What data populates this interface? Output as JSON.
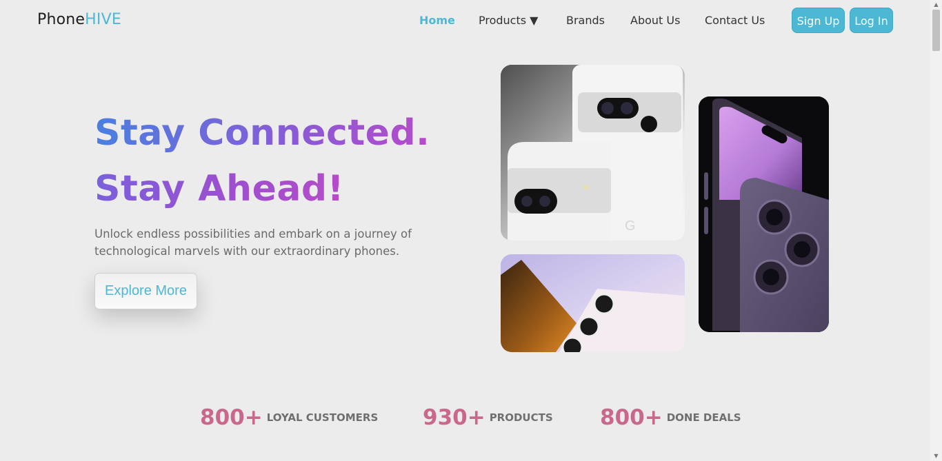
{
  "logo": {
    "part1": "Phone",
    "part2": "HIVE"
  },
  "nav": {
    "home": "Home",
    "products": "Products ▼",
    "brands": "Brands",
    "about": "About Us",
    "contact": "Contact Us",
    "signup": "Sign Up",
    "login": "Log In"
  },
  "hero": {
    "title1": "Stay Connected.",
    "title2": "Stay Ahead!",
    "subtitle": "Unlock endless possibilities and embark on a journey of technological marvels with our extraordinary phones.",
    "cta": "Explore More"
  },
  "stats": [
    {
      "num": "800+",
      "label": "LOYAL CUSTOMERS"
    },
    {
      "num": "930+",
      "label": "PRODUCTS"
    },
    {
      "num": "800+",
      "label": "DONE DEALS"
    }
  ],
  "colors": {
    "accent": "#4cb8d4",
    "stat_number": "#c9688c",
    "background": "#ececec"
  },
  "images": {
    "phone1": "white-pixel-phones",
    "phone2": "lavender-galaxy-phone",
    "phone3": "purple-iphone-pro"
  }
}
